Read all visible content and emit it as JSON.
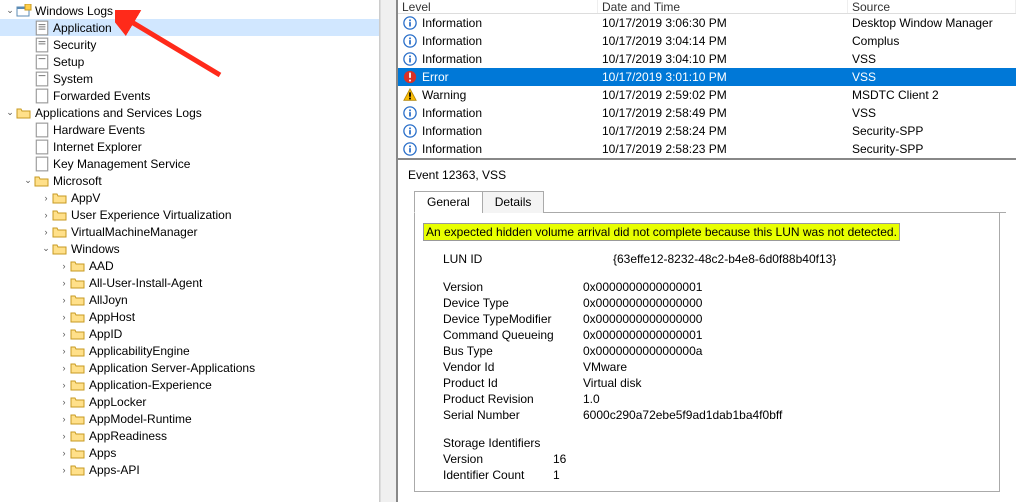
{
  "tree": {
    "windowsLogs": "Windows Logs",
    "application": "Application",
    "security": "Security",
    "setup": "Setup",
    "system": "System",
    "forwarded": "Forwarded Events",
    "appServices": "Applications and Services Logs",
    "hardwareEvents": "Hardware Events",
    "internetExplorer": "Internet Explorer",
    "keyMgmt": "Key Management Service",
    "microsoft": "Microsoft",
    "appV": "AppV",
    "uev": "User Experience Virtualization",
    "vmm": "VirtualMachineManager",
    "windows": "Windows",
    "aad": "AAD",
    "allUser": "All-User-Install-Agent",
    "allJoyn": "AllJoyn",
    "appHost": "AppHost",
    "appID": "AppID",
    "applicability": "ApplicabilityEngine",
    "appServer": "Application Server-Applications",
    "appExp": "Application-Experience",
    "appLocker": "AppLocker",
    "appModel": "AppModel-Runtime",
    "appReadiness": "AppReadiness",
    "apps": "Apps",
    "appsApi": "Apps-API"
  },
  "header": {
    "level": "Level",
    "date": "Date and Time",
    "source": "Source"
  },
  "events": [
    {
      "level": "Information",
      "type": "info",
      "date": "10/17/2019 3:06:30 PM",
      "source": "Desktop Window Manager"
    },
    {
      "level": "Information",
      "type": "info",
      "date": "10/17/2019 3:04:14 PM",
      "source": "Complus"
    },
    {
      "level": "Information",
      "type": "info",
      "date": "10/17/2019 3:04:10 PM",
      "source": "VSS"
    },
    {
      "level": "Error",
      "type": "error",
      "date": "10/17/2019 3:01:10 PM",
      "source": "VSS",
      "selected": true
    },
    {
      "level": "Warning",
      "type": "warn",
      "date": "10/17/2019 2:59:02 PM",
      "source": "MSDTC Client 2"
    },
    {
      "level": "Information",
      "type": "info",
      "date": "10/17/2019 2:58:49 PM",
      "source": "VSS"
    },
    {
      "level": "Information",
      "type": "info",
      "date": "10/17/2019 2:58:24 PM",
      "source": "Security-SPP"
    },
    {
      "level": "Information",
      "type": "info",
      "date": "10/17/2019 2:58:23 PM",
      "source": "Security-SPP"
    }
  ],
  "detail": {
    "title": "Event 12363, VSS",
    "tabGeneral": "General",
    "tabDetails": "Details",
    "message": "An expected hidden volume arrival did not complete because this LUN was not detected.",
    "kv": [
      {
        "k": "LUN ID",
        "v": "{63effe12-8232-48c2-b4e8-6d0f88b40f13}"
      }
    ],
    "kv2": [
      {
        "k": "Version",
        "v": "0x0000000000000001"
      },
      {
        "k": "Device Type",
        "v": "0x0000000000000000"
      },
      {
        "k": "Device TypeModifier",
        "v": "0x0000000000000000"
      },
      {
        "k": "Command Queueing",
        "v": "0x0000000000000001"
      },
      {
        "k": "Bus Type",
        "v": "0x000000000000000a"
      },
      {
        "k": "Vendor Id",
        "v": "VMware"
      },
      {
        "k": "Product Id",
        "v": "Virtual disk"
      },
      {
        "k": "Product Revision",
        "v": "1.0"
      },
      {
        "k": "Serial Number",
        "v": "6000c290a72ebe5f9ad1dab1ba4f0bff"
      }
    ],
    "storageHeader": "Storage Identifiers",
    "kv3": [
      {
        "k": "Version",
        "v": "16"
      },
      {
        "k": "Identifier Count",
        "v": "1"
      }
    ]
  }
}
